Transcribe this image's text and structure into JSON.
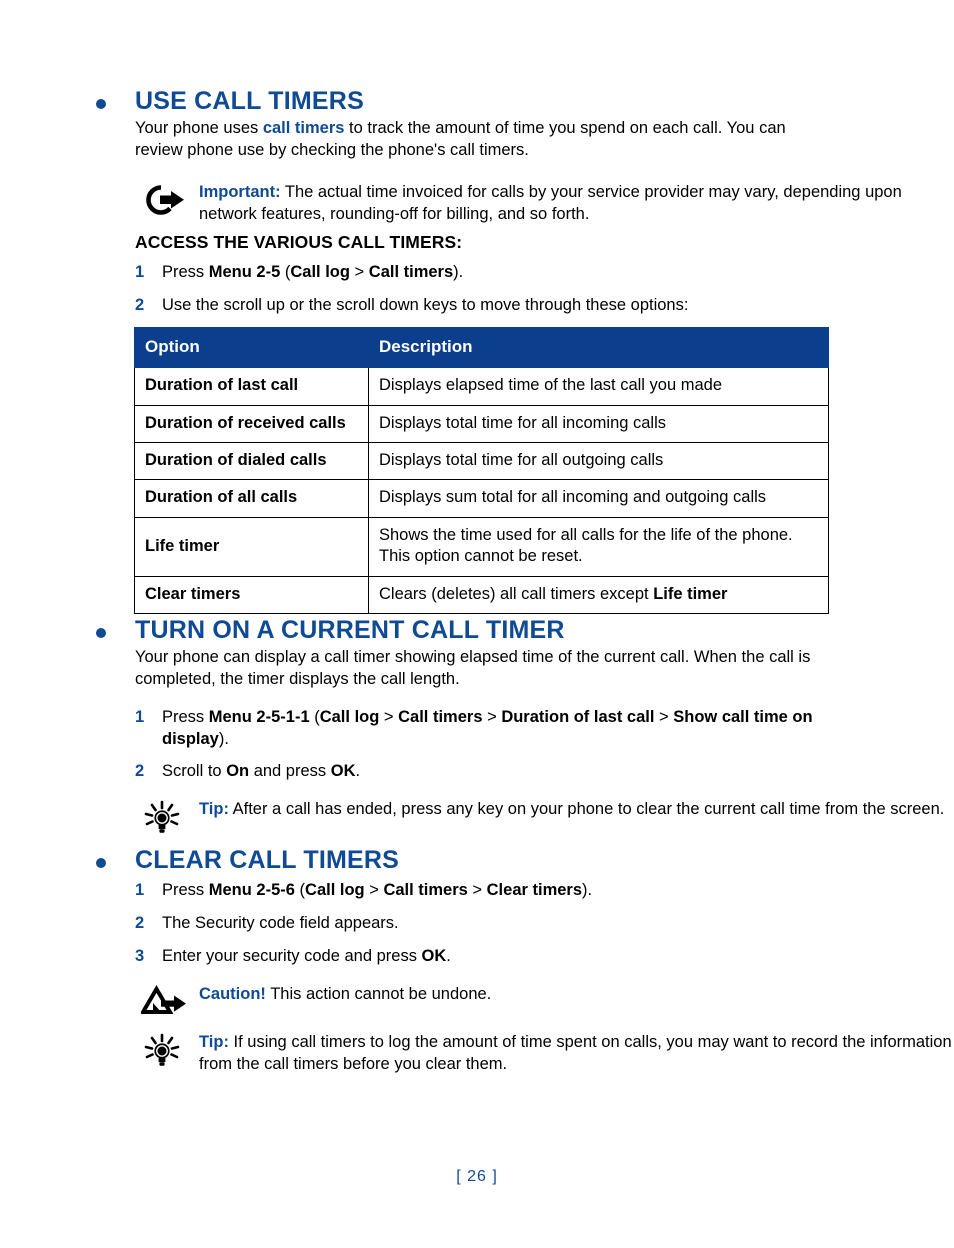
{
  "page": {
    "number": "[ 26 ]",
    "accent_blue": "#0f4a94",
    "table_header_blue": "#0b3e8c"
  },
  "sections": {
    "use_call_timers": {
      "heading": "USE CALL TIMERS",
      "intro_prefix": "Your phone uses ",
      "intro_highlight": "call timers",
      "intro_suffix": " to track the amount of time you spend on each call. You can review phone use by checking the phone's call timers.",
      "important_note": {
        "icon": "important-arrow-circle-icon",
        "label": "Important:",
        "text": " The actual time invoiced for calls by your service provider may vary, depending upon network features, rounding-off for billing, and so forth."
      },
      "sub_heading": "ACCESS THE VARIOUS CALL TIMERS:",
      "steps": [
        {
          "num": "1",
          "parts": [
            {
              "t": "Press ",
              "b": false
            },
            {
              "t": "Menu 2-5",
              "b": true
            },
            {
              "t": " (",
              "b": false
            },
            {
              "t": "Call log",
              "b": true
            },
            {
              "t": " > ",
              "b": false
            },
            {
              "t": "Call timers",
              "b": true
            },
            {
              "t": ").",
              "b": false
            }
          ]
        },
        {
          "num": "2",
          "parts": [
            {
              "t": "Use the scroll up or the scroll down keys to move through these options:",
              "b": false
            }
          ]
        }
      ]
    },
    "turn_on_current_call_timer": {
      "heading": "TURN ON A CURRENT CALL TIMER",
      "intro": "Your phone can display a call timer showing elapsed time of the current call. When the call is completed, the timer displays the call length.",
      "steps": [
        {
          "num": "1",
          "parts": [
            {
              "t": "Press ",
              "b": false
            },
            {
              "t": "Menu 2-5-1-1",
              "b": true
            },
            {
              "t": " (",
              "b": false
            },
            {
              "t": "Call log",
              "b": true
            },
            {
              "t": " > ",
              "b": false
            },
            {
              "t": "Call timers",
              "b": true
            },
            {
              "t": " > ",
              "b": false
            },
            {
              "t": "Duration of last call",
              "b": true
            },
            {
              "t": " > ",
              "b": false
            },
            {
              "t": "Show call time on display",
              "b": true
            },
            {
              "t": ").",
              "b": false
            }
          ]
        },
        {
          "num": "2",
          "parts": [
            {
              "t": "Scroll to ",
              "b": false
            },
            {
              "t": "On",
              "b": true
            },
            {
              "t": " and press ",
              "b": false
            },
            {
              "t": "OK",
              "b": true
            },
            {
              "t": ".",
              "b": false
            }
          ]
        }
      ],
      "tip_note": {
        "icon": "tip-lightbulb-icon",
        "label": "Tip:",
        "text": " After a call has ended, press any key on your phone to clear the current call time from the screen."
      }
    },
    "clear_call_timers": {
      "heading": "CLEAR CALL TIMERS",
      "steps": [
        {
          "num": "1",
          "parts": [
            {
              "t": "Press ",
              "b": false
            },
            {
              "t": "Menu 2-5-6",
              "b": true
            },
            {
              "t": " (",
              "b": false
            },
            {
              "t": "Call log",
              "b": true
            },
            {
              "t": " > ",
              "b": false
            },
            {
              "t": "Call timers",
              "b": true
            },
            {
              "t": " > ",
              "b": false
            },
            {
              "t": "Clear timers",
              "b": true
            },
            {
              "t": ").",
              "b": false
            }
          ]
        },
        {
          "num": "2",
          "parts": [
            {
              "t": "The Security code field appears.",
              "b": false
            }
          ]
        },
        {
          "num": "3",
          "parts": [
            {
              "t": "Enter your security code and press ",
              "b": false
            },
            {
              "t": "OK",
              "b": true
            },
            {
              "t": ".",
              "b": false
            }
          ]
        }
      ],
      "caution_note": {
        "icon": "caution-triangle-arrow-icon",
        "label": "Caution!",
        "text": " This action cannot be undone."
      },
      "tip_note": {
        "icon": "tip-lightbulb-icon",
        "label": "Tip:",
        "text": " If using call timers to log the amount of time spent on calls, you may want to record the information from the call timers before you clear them."
      }
    }
  },
  "options_table": {
    "headers": [
      "Option",
      "Description"
    ],
    "rows": [
      {
        "option": "Duration of last call",
        "desc_parts": [
          {
            "t": "Displays elapsed time of the last call you made",
            "b": false
          }
        ]
      },
      {
        "option": "Duration of received calls",
        "desc_parts": [
          {
            "t": "Displays total time for all incoming calls",
            "b": false
          }
        ]
      },
      {
        "option": "Duration of dialed calls",
        "desc_parts": [
          {
            "t": "Displays total time for all outgoing calls",
            "b": false
          }
        ]
      },
      {
        "option": "Duration of all calls",
        "desc_parts": [
          {
            "t": "Displays sum total for all incoming and outgoing calls",
            "b": false
          }
        ]
      },
      {
        "option": "Life timer",
        "desc_parts": [
          {
            "t": "Shows the time used for all calls for the life of the phone. This option cannot be reset.",
            "b": false
          }
        ]
      },
      {
        "option": "Clear timers",
        "desc_parts": [
          {
            "t": "Clears (deletes) all call timers except ",
            "b": false
          },
          {
            "t": "Life timer",
            "b": true
          }
        ]
      }
    ]
  }
}
